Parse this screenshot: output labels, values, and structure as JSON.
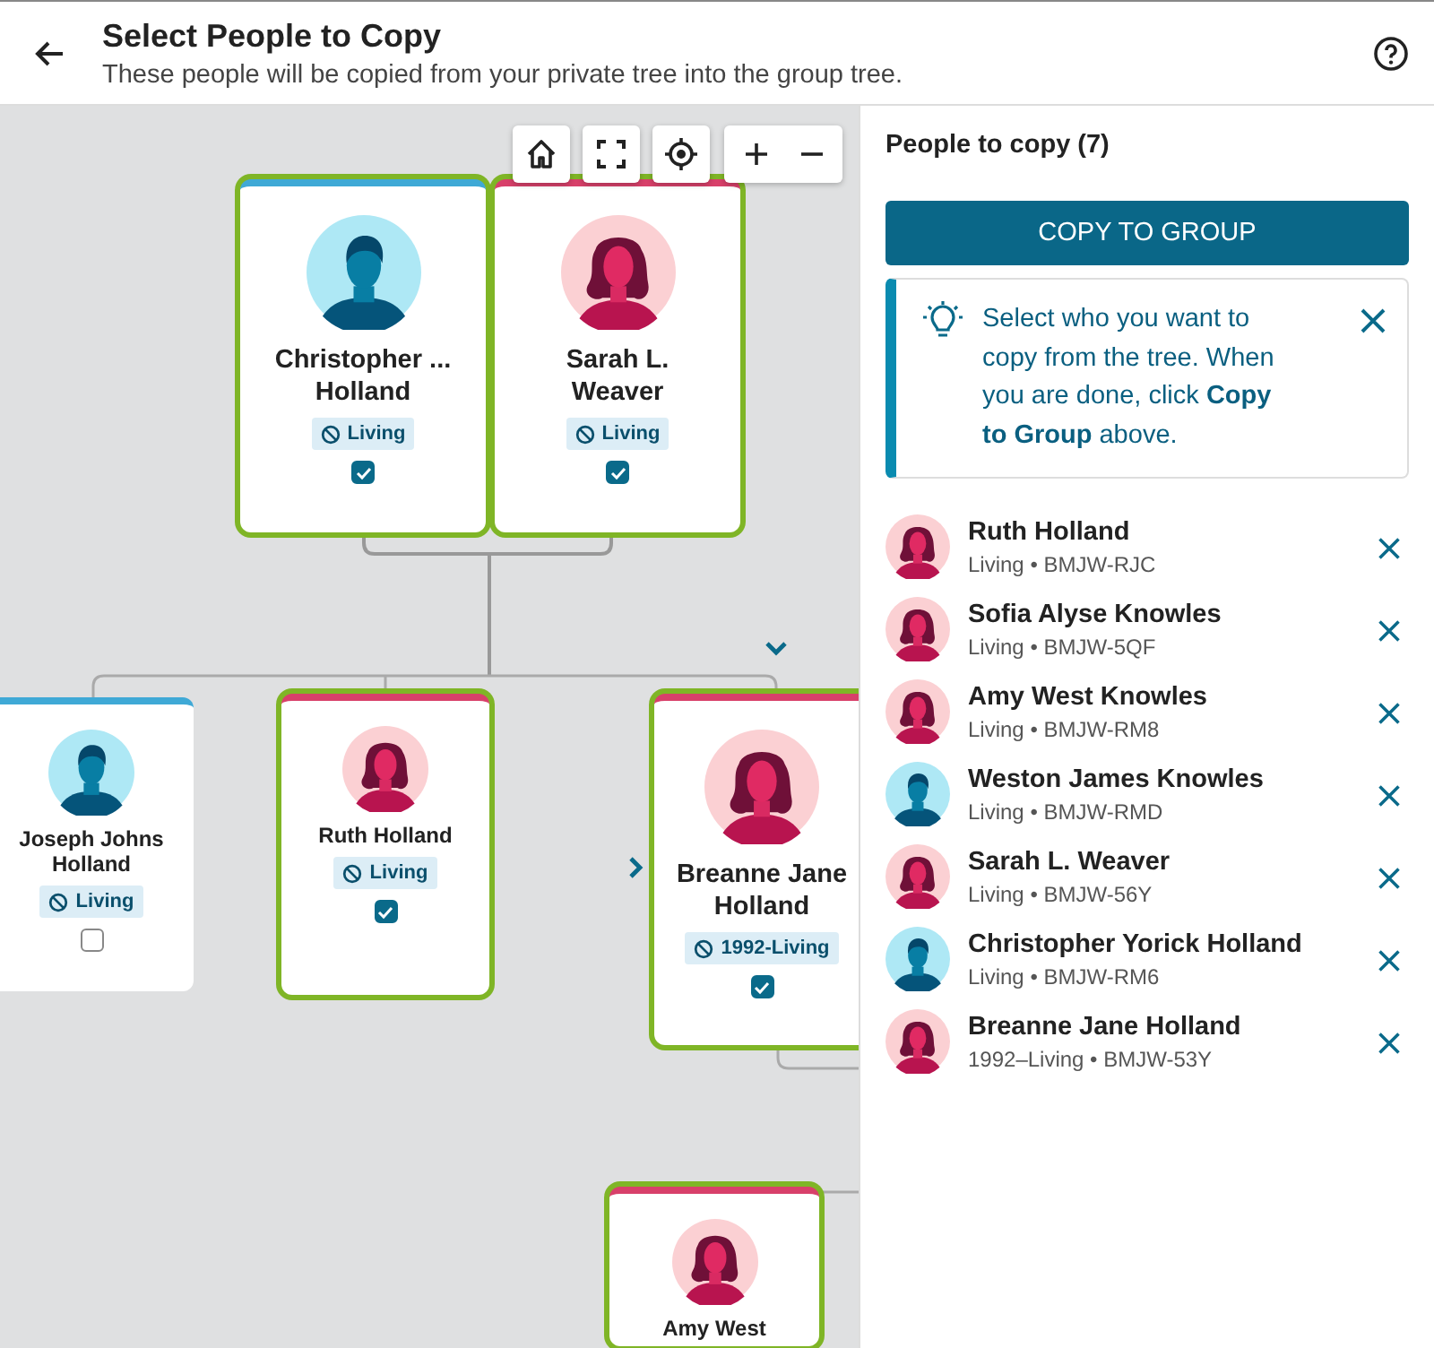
{
  "header": {
    "title": "Select People to Copy",
    "subtitle": "These people will be copied from your private tree into the group tree."
  },
  "tree": {
    "cards": [
      {
        "name": "Christopher ... Holland",
        "kind": "male",
        "badge": "Living",
        "selected": true,
        "checked": true
      },
      {
        "name": "Sarah L. Weaver",
        "kind": "female",
        "badge": "Living",
        "selected": true,
        "checked": true
      },
      {
        "name": "Joseph Johns Holland",
        "kind": "male",
        "badge": "Living",
        "selected": false,
        "checked": false
      },
      {
        "name": "Ruth Holland",
        "kind": "female",
        "badge": "Living",
        "selected": true,
        "checked": true
      },
      {
        "name": "Breanne Jane Holland",
        "kind": "female",
        "badge": "1992-Living",
        "selected": true,
        "checked": true
      },
      {
        "name": "Amy West",
        "kind": "female",
        "selected": true
      }
    ]
  },
  "panel": {
    "title": "People to copy (7)",
    "button": "COPY TO GROUP",
    "hint": "Select who you want to copy from the tree. When you are done, click **Copy to Group** above.",
    "people": [
      {
        "name": "Ruth Holland",
        "kind": "female",
        "meta": "Living • BMJW-RJC"
      },
      {
        "name": "Sofia Alyse Knowles",
        "kind": "female",
        "meta": "Living • BMJW-5QF"
      },
      {
        "name": "Amy West Knowles",
        "kind": "female",
        "meta": "Living • BMJW-RM8"
      },
      {
        "name": "Weston James Knowles",
        "kind": "male",
        "meta": "Living • BMJW-RMD"
      },
      {
        "name": "Sarah L. Weaver",
        "kind": "female",
        "meta": "Living • BMJW-56Y"
      },
      {
        "name": "Christopher Yorick Holland",
        "kind": "male",
        "meta": "Living • BMJW-RM6"
      },
      {
        "name": "Breanne Jane Holland",
        "kind": "female",
        "meta": "1992–Living • BMJW-53Y"
      }
    ]
  }
}
